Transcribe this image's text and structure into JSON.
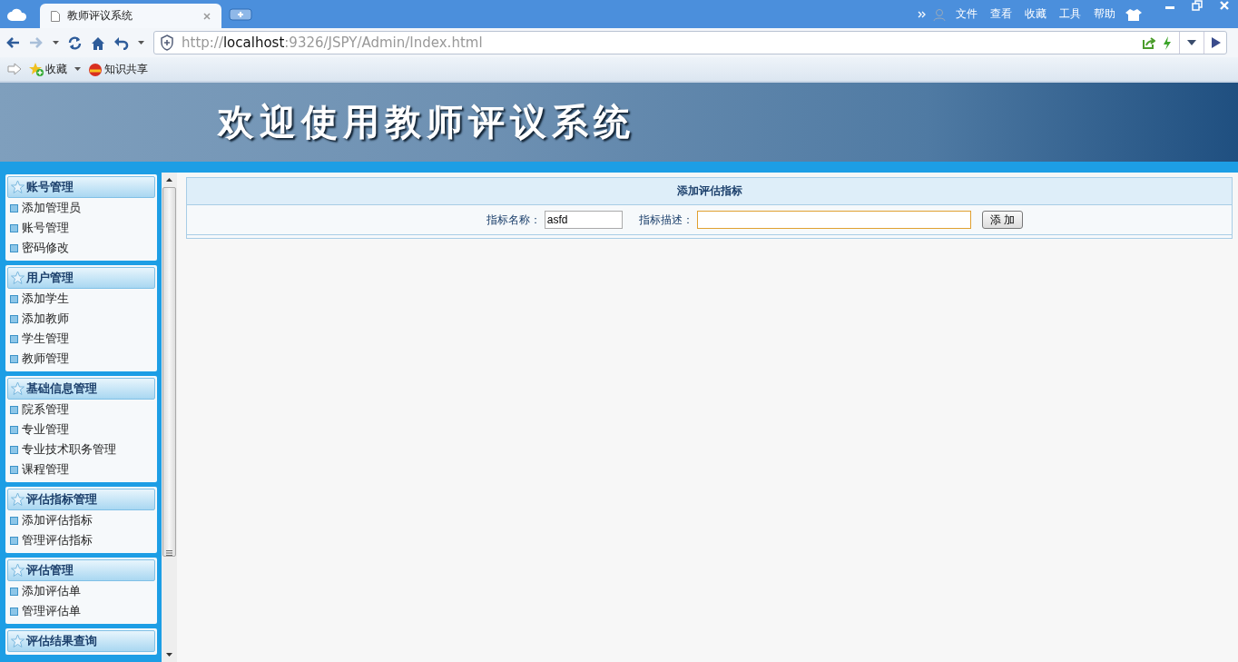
{
  "browser": {
    "tab_title": "教师评议系统",
    "menu": [
      "文件",
      "查看",
      "收藏",
      "工具",
      "帮助"
    ],
    "url_scheme": "http://",
    "url_host": "localhost",
    "url_rest": ":9326/JSPY/Admin/Index.html",
    "bookmarks": [
      "收藏",
      "知识共享"
    ]
  },
  "banner": {
    "title": "欢迎使用教师评议系统"
  },
  "sidebar": {
    "groups": [
      {
        "title": "账号管理",
        "items": [
          "添加管理员",
          "账号管理",
          "密码修改"
        ]
      },
      {
        "title": "用户管理",
        "items": [
          "添加学生",
          "添加教师",
          "学生管理",
          "教师管理"
        ]
      },
      {
        "title": "基础信息管理",
        "items": [
          "院系管理",
          "专业管理",
          "专业技术职务管理",
          "课程管理"
        ]
      },
      {
        "title": "评估指标管理",
        "items": [
          "添加评估指标",
          "管理评估指标"
        ]
      },
      {
        "title": "评估管理",
        "items": [
          "添加评估单",
          "管理评估单"
        ]
      },
      {
        "title": "评估结果查询"
      }
    ]
  },
  "form": {
    "title": "添加评估指标",
    "fields": [
      {
        "label": "指标名称：",
        "value": "asfd",
        "focused": false
      },
      {
        "label": "指标描述：",
        "focused": true
      }
    ],
    "submit": "添 加"
  }
}
